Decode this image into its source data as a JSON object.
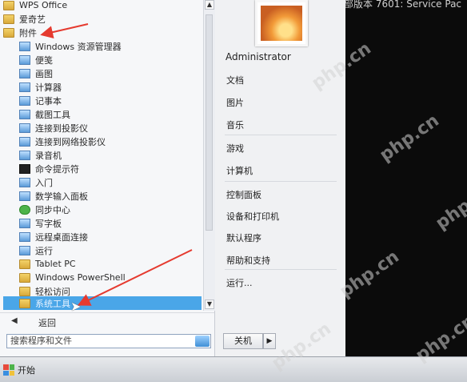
{
  "desktop": {
    "caption": "部版本 7601: Service Pac"
  },
  "start_menu": {
    "programs": [
      {
        "label": "WPS Office",
        "type": "folder"
      },
      {
        "label": "爱奇艺",
        "type": "folder"
      },
      {
        "label": "附件",
        "type": "folder"
      },
      {
        "label": "Windows 资源管理器",
        "type": "app"
      },
      {
        "label": "便笺",
        "type": "app"
      },
      {
        "label": "画图",
        "type": "app"
      },
      {
        "label": "计算器",
        "type": "app"
      },
      {
        "label": "记事本",
        "type": "app"
      },
      {
        "label": "截图工具",
        "type": "app"
      },
      {
        "label": "连接到投影仪",
        "type": "app"
      },
      {
        "label": "连接到网络投影仪",
        "type": "app"
      },
      {
        "label": "录音机",
        "type": "app"
      },
      {
        "label": "命令提示符",
        "type": "app"
      },
      {
        "label": "入门",
        "type": "app"
      },
      {
        "label": "数学输入面板",
        "type": "app"
      },
      {
        "label": "同步中心",
        "type": "app"
      },
      {
        "label": "写字板",
        "type": "app"
      },
      {
        "label": "远程桌面连接",
        "type": "app"
      },
      {
        "label": "运行",
        "type": "app"
      },
      {
        "label": "Tablet PC",
        "type": "folder"
      },
      {
        "label": "Windows PowerShell",
        "type": "folder"
      },
      {
        "label": "轻松访问",
        "type": "folder"
      },
      {
        "label": "系统工具",
        "type": "folder",
        "selected": true
      }
    ],
    "back_label": "返回",
    "search_placeholder": "搜索程序和文件",
    "right": {
      "user": "Administrator",
      "items_group1": [
        "文档",
        "图片",
        "音乐"
      ],
      "items_group2": [
        "游戏",
        "计算机"
      ],
      "items_group3": [
        "控制面板",
        "设备和打印机",
        "默认程序",
        "帮助和支持"
      ],
      "items_group4": [
        "运行..."
      ]
    },
    "shutdown_label": "关机",
    "shutdown_arrow": "▶"
  },
  "taskbar": {
    "start_label": "开始"
  },
  "watermark": "php.cn",
  "colors": {
    "selection": "#4aa6e8",
    "arrow": "#e53a2f"
  }
}
